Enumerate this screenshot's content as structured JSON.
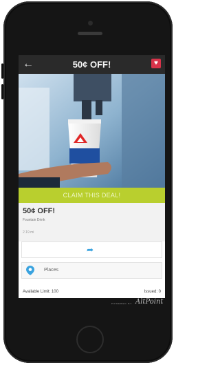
{
  "app": {
    "title": "50¢ OFF!",
    "back_icon": "arrow-left-icon",
    "favorite_icon": "heart-icon",
    "accent_color": "#d8334a"
  },
  "photo": {
    "description_icon": "drink-cup-photo"
  },
  "claim": {
    "label": "CLAIM THIS DEAL!",
    "color": "#b9cf2e"
  },
  "deal": {
    "title": "50¢ OFF!",
    "merchant": "Fountain Drink",
    "distance": "2.19 mi"
  },
  "share": {
    "icon": "share-arrow-icon"
  },
  "places": {
    "label": "Places",
    "icon": "map-pin-icon"
  },
  "limits": {
    "available_label": "Available Limit: 100",
    "issued_label": "Issued: 0"
  },
  "footer": {
    "powered": "POWERED BY",
    "brand": "AltPoint"
  }
}
